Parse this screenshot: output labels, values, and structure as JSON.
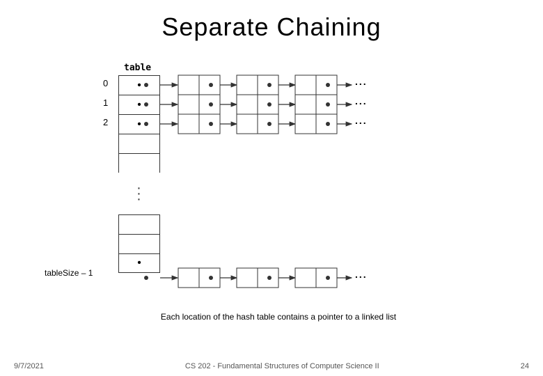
{
  "title": "Separate Chaining",
  "table_label": "table",
  "row_labels": [
    "0",
    "1",
    "2"
  ],
  "bottom_row_label": "tableSize – 1",
  "caption": "Each location of the hash table contains a pointer to a linked list",
  "footer": {
    "date": "9/7/2021",
    "course": "CS 202 - Fundamental Structures of Computer Science II",
    "page_number": "24"
  },
  "ellipsis": "...",
  "vertical_dots": "⋮"
}
